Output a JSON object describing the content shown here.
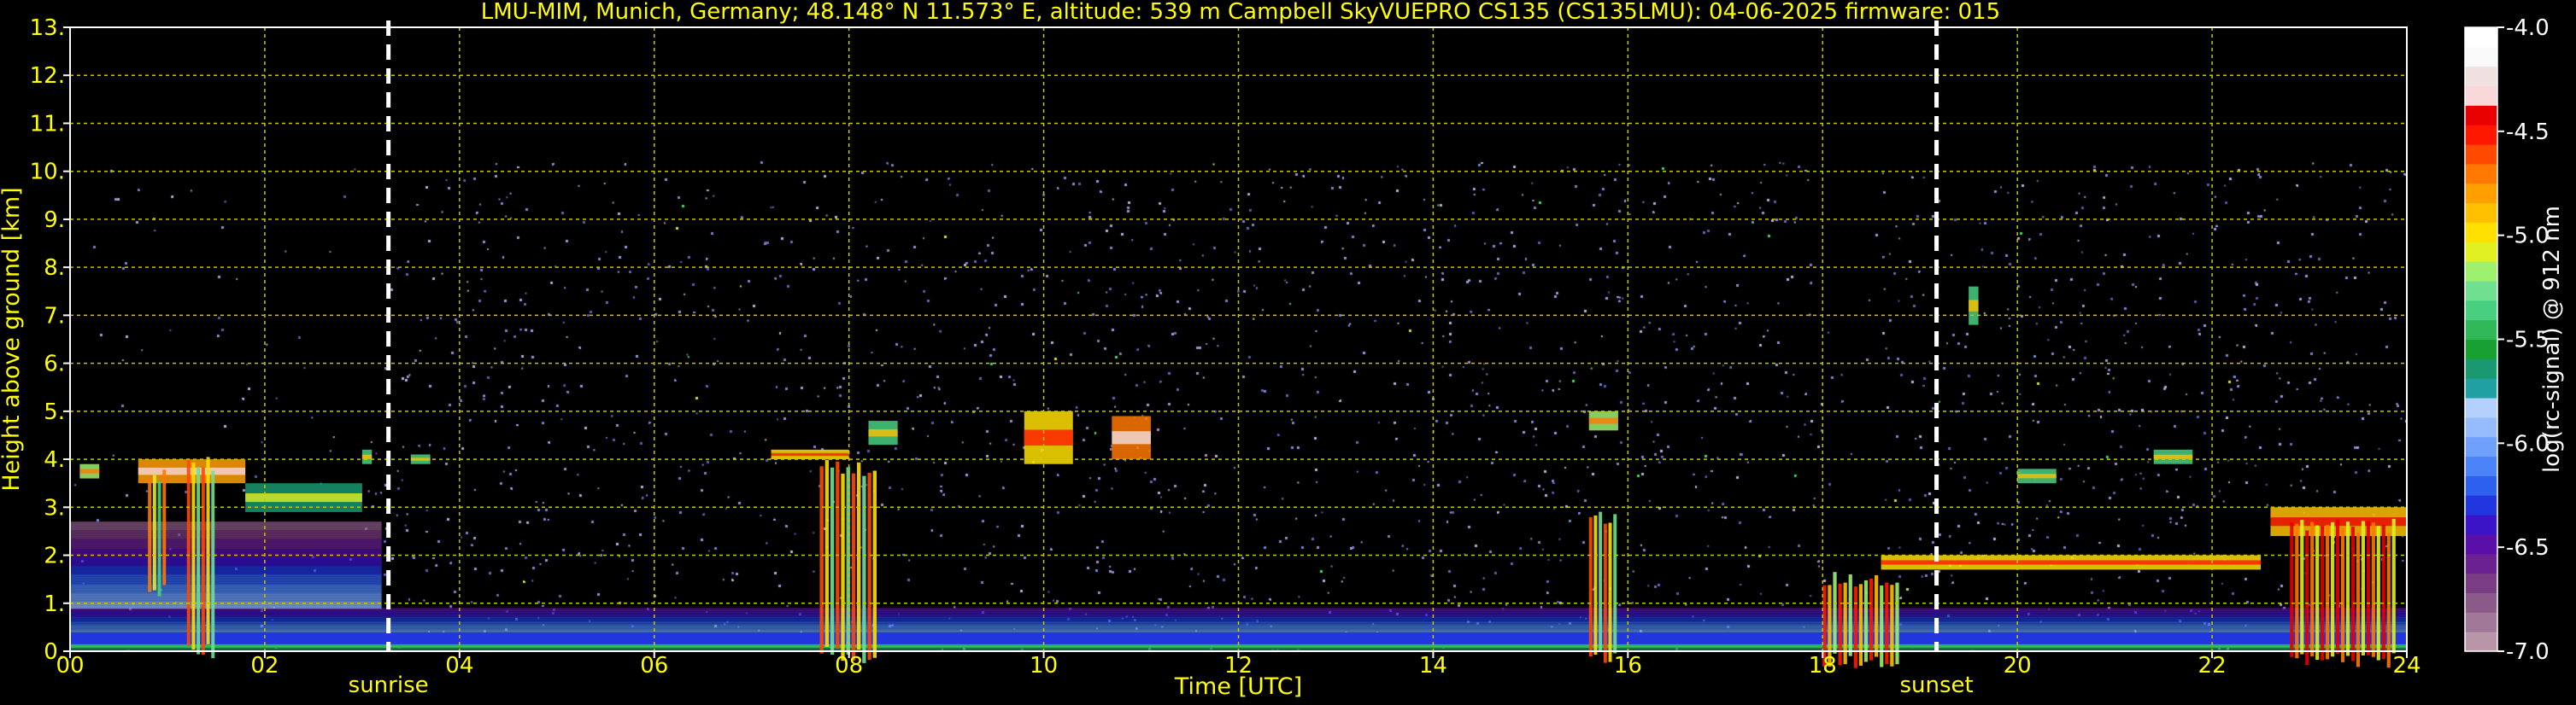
{
  "title": "LMU-MIM, Munich, Germany; 48.148° N 11.573° E, altitude: 539 m    Campbell SkyVUEPRO CS135 (CS135LMU): 04-06-2025    firmware: 015",
  "colors": {
    "background": "#000000",
    "text": "#ffff00",
    "grid": "#c8c800",
    "frame": "#ffffff",
    "colorbar_label": "#ffffff"
  },
  "chart_data": {
    "type": "heatmap",
    "xlabel": "Time [UTC]",
    "ylabel": "Height above ground [km]",
    "xlim": [
      0,
      24
    ],
    "ylim": [
      0,
      13
    ],
    "x_ticks": [
      "00",
      "02",
      "04",
      "06",
      "08",
      "10",
      "12",
      "14",
      "16",
      "18",
      "20",
      "22",
      "24"
    ],
    "y_ticks": [
      "0.",
      "1.",
      "2.",
      "3.",
      "4.",
      "5.",
      "6.",
      "7.",
      "8.",
      "9.",
      "10.",
      "11.",
      "12.",
      "13."
    ],
    "grid": true,
    "data_top_km": 10.2,
    "markers": [
      {
        "label": "sunrise",
        "time_h": 3.27
      },
      {
        "label": "sunset",
        "time_h": 19.17
      }
    ],
    "colorbar": {
      "label": "log(rc-signal) @ 912 nm",
      "range": [
        -7.0,
        -4.0
      ],
      "ticks": [
        "-4.0",
        "-4.5",
        "-5.0",
        "-5.5",
        "-6.0",
        "-6.5",
        "-7.0"
      ],
      "colors": [
        "#b896a8",
        "#a27898",
        "#8c5a88",
        "#7a3c82",
        "#6a2290",
        "#5a10a8",
        "#3c14c8",
        "#2236e0",
        "#2e60f0",
        "#4a84f8",
        "#6ea0fc",
        "#96bcfc",
        "#b4d0fc",
        "#20a0a0",
        "#1a9870",
        "#18a030",
        "#30b858",
        "#48d080",
        "#70e090",
        "#a0f070",
        "#e0f020",
        "#ffe000",
        "#ffc000",
        "#ffa000",
        "#ff7800",
        "#ff4800",
        "#ff1800",
        "#e80000",
        "#f8d8d8",
        "#f0e0e0",
        "#fafafa",
        "#ffffff"
      ]
    },
    "layers": [
      {
        "name": "boundary layer",
        "t_start": 0,
        "t_end": 24,
        "h_bottom": 0,
        "h_top": 0.9,
        "value": -6.3
      },
      {
        "name": "morning residual layer",
        "t_start": 0,
        "t_end": 3.2,
        "h_bottom": 0.9,
        "h_top": 2.7,
        "value": -6.6
      }
    ],
    "cloud_layers": [
      {
        "t_start": 0.1,
        "t_end": 0.3,
        "h_bottom": 3.6,
        "h_top": 3.9,
        "value": -5.2
      },
      {
        "t_start": 0.7,
        "t_end": 1.8,
        "h_bottom": 3.5,
        "h_top": 4.0,
        "value": -4.8
      },
      {
        "t_start": 1.8,
        "t_end": 3.0,
        "h_bottom": 2.9,
        "h_top": 3.5,
        "value": -5.6
      },
      {
        "t_start": 3.0,
        "t_end": 3.1,
        "h_bottom": 3.9,
        "h_top": 4.2,
        "value": -5.4
      },
      {
        "t_start": 3.5,
        "t_end": 3.7,
        "h_bottom": 3.9,
        "h_top": 4.1,
        "value": -5.4
      },
      {
        "t_start": 7.2,
        "t_end": 8.0,
        "h_bottom": 4.0,
        "h_top": 4.2,
        "value": -5.0
      },
      {
        "t_start": 8.2,
        "t_end": 8.5,
        "h_bottom": 4.3,
        "h_top": 4.8,
        "value": -5.4
      },
      {
        "t_start": 9.8,
        "t_end": 10.3,
        "h_bottom": 3.9,
        "h_top": 5.0,
        "value": -5.0
      },
      {
        "t_start": 10.7,
        "t_end": 11.1,
        "h_bottom": 4.0,
        "h_top": 4.9,
        "value": -4.7
      },
      {
        "t_start": 15.6,
        "t_end": 15.9,
        "h_bottom": 4.6,
        "h_top": 5.0,
        "value": -5.2
      },
      {
        "t_start": 18.6,
        "t_end": 22.5,
        "h_bottom": 1.7,
        "h_top": 2.0,
        "value": -5.0
      },
      {
        "t_start": 19.5,
        "t_end": 19.6,
        "h_bottom": 6.8,
        "h_top": 7.6,
        "value": -5.4
      },
      {
        "t_start": 20.0,
        "t_end": 20.4,
        "h_bottom": 3.5,
        "h_top": 3.8,
        "value": -5.4
      },
      {
        "t_start": 21.4,
        "t_end": 21.8,
        "h_bottom": 3.9,
        "h_top": 4.2,
        "value": -5.4
      },
      {
        "t_start": 22.6,
        "t_end": 24.0,
        "h_bottom": 2.4,
        "h_top": 3.0,
        "value": -4.9
      }
    ],
    "precipitation": [
      {
        "t_start": 0.8,
        "t_end": 1.0,
        "h_bottom": 1.5,
        "h_top": 3.9,
        "value": -4.7
      },
      {
        "t_start": 1.2,
        "t_end": 1.5,
        "h_bottom": 0.2,
        "h_top": 4.1,
        "value": -4.6
      },
      {
        "t_start": 7.7,
        "t_end": 8.3,
        "h_bottom": 0.1,
        "h_top": 4.0,
        "value": -4.6
      },
      {
        "t_start": 15.6,
        "t_end": 15.9,
        "h_bottom": 0.1,
        "h_top": 3.0,
        "value": -4.6
      },
      {
        "t_start": 18.0,
        "t_end": 18.8,
        "h_bottom": 0.0,
        "h_top": 1.7,
        "value": -4.5
      },
      {
        "t_start": 22.8,
        "t_end": 23.9,
        "h_bottom": 0.0,
        "h_top": 2.8,
        "value": -4.4
      }
    ]
  }
}
